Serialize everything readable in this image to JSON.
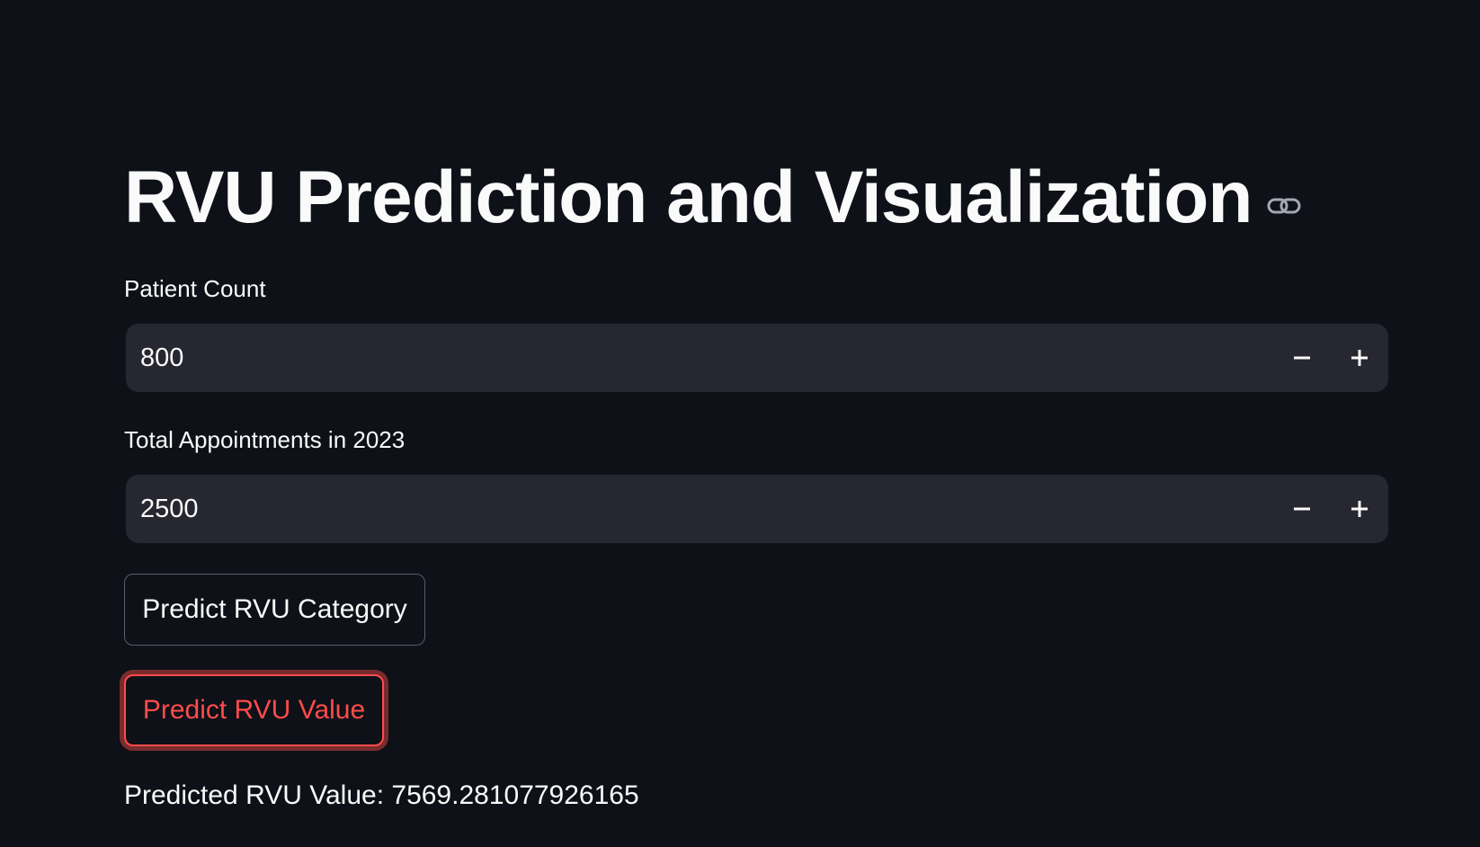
{
  "page": {
    "title": "RVU Prediction and Visualization",
    "anchor_icon": "link-icon"
  },
  "fields": [
    {
      "label": "Patient Count",
      "value": "800"
    },
    {
      "label": "Total Appointments in 2023",
      "value": "2500"
    }
  ],
  "stepper": {
    "decrement_icon": "minus-icon",
    "increment_icon": "plus-icon"
  },
  "buttons": {
    "predict_category": "Predict RVU Category",
    "predict_value": "Predict RVU Value"
  },
  "result": {
    "text": "Predicted RVU Value: 7569.281077926165"
  },
  "colors": {
    "background": "#0e1117",
    "input_bg": "#262730",
    "accent": "#ff4b4b",
    "text": "#fafafa"
  }
}
